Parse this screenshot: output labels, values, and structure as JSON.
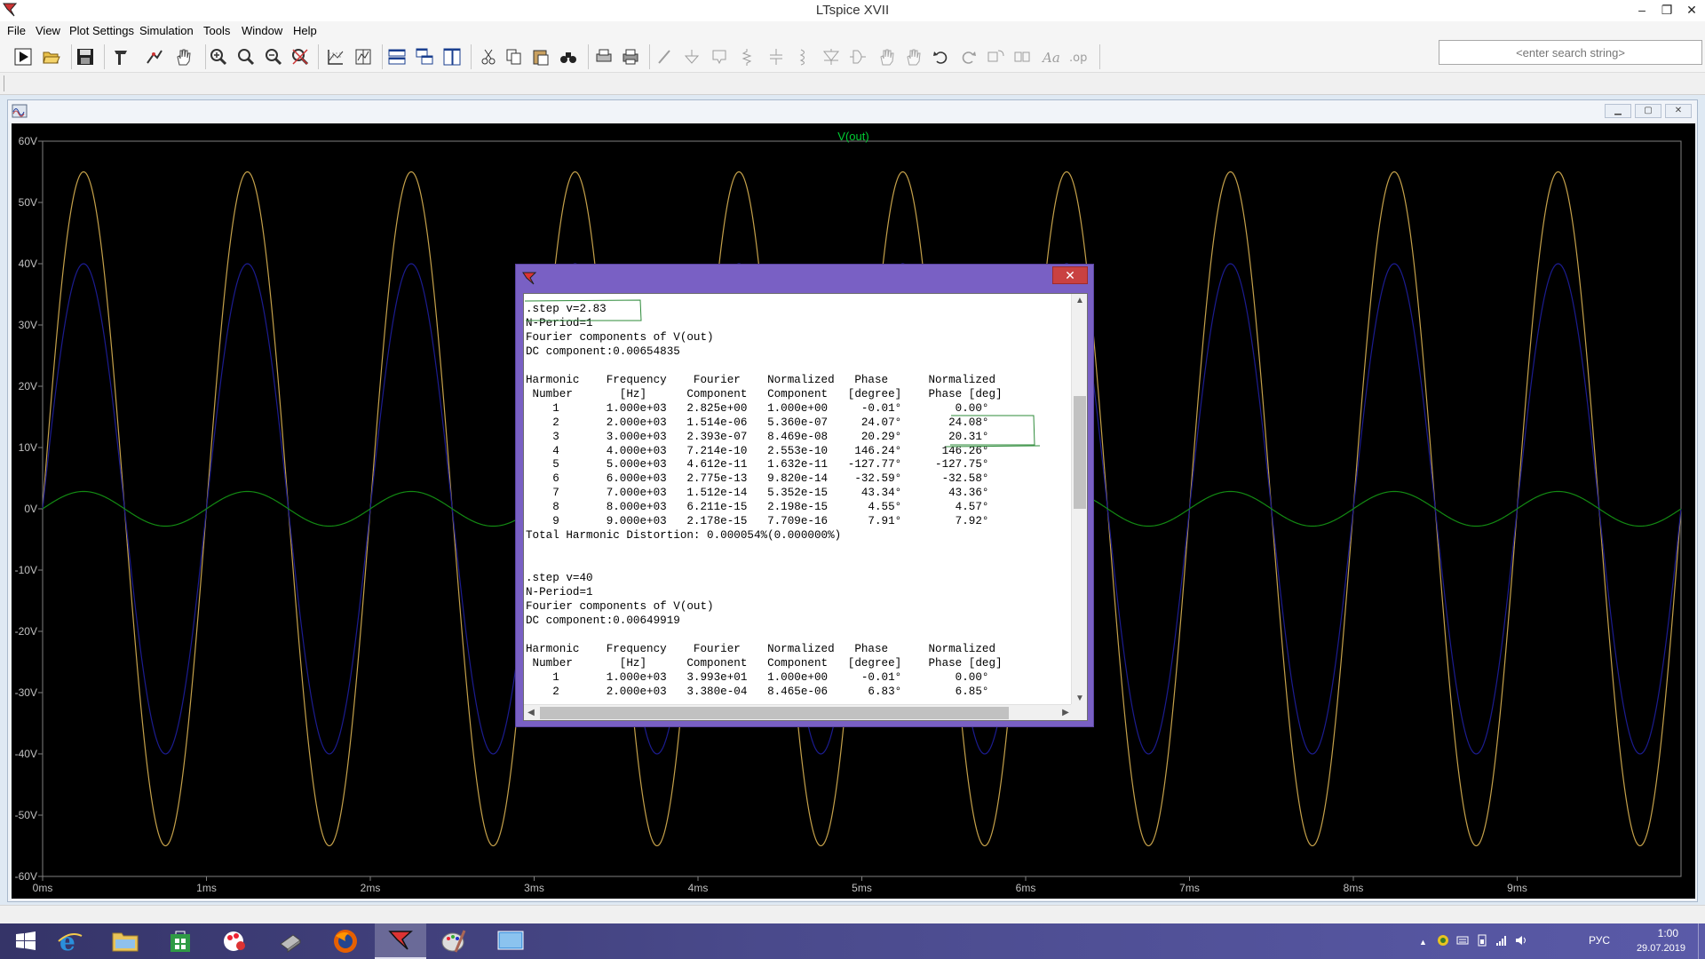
{
  "app": {
    "title": "LTspice XVII"
  },
  "window_controls": {
    "minimize": "–",
    "restore": "❐",
    "close": "✕"
  },
  "menu": [
    "File",
    "View",
    "Plot Settings",
    "Simulation",
    "Tools",
    "Window",
    "Help"
  ],
  "toolbar_icons": [
    "run-icon",
    "open-icon",
    "save-icon",
    "control-panel-icon",
    "pick-visible-traces-icon",
    "pan-icon",
    "zoom-in-icon",
    "zoom-area-icon",
    "zoom-out-icon",
    "zoom-fit-icon",
    "autorange-icon",
    "autorange-y-icon",
    "tile-horizontal-icon",
    "cascade-icon",
    "tile-vertical-icon",
    "cut-icon",
    "copy-icon",
    "paste-icon",
    "find-icon",
    "print-preview-icon",
    "print-icon",
    "wire-icon",
    "ground-icon",
    "label-net-icon",
    "resistor-icon",
    "capacitor-icon",
    "inductor-icon",
    "diode-icon",
    "component-icon",
    "move-icon",
    "drag-icon",
    "undo-icon",
    "redo-icon",
    "rotate-icon",
    "mirror-icon",
    "text-icon",
    "spice-directive-icon"
  ],
  "search": {
    "placeholder": "<enter search string>"
  },
  "plot": {
    "trace_label": "V(out)",
    "colors": {
      "background": "#000000",
      "grid": "#7f7f7f",
      "axis_text": "#c0c0c0",
      "trace_orange": "#c5a14a",
      "trace_blue": "#1c1c90",
      "trace_green": "#138a13",
      "label": "#00cc33"
    }
  },
  "chart_data": {
    "type": "line",
    "title": "V(out)",
    "xlabel": "",
    "ylabel": "",
    "x_ticks": [
      "0ms",
      "1ms",
      "2ms",
      "3ms",
      "4ms",
      "5ms",
      "6ms",
      "7ms",
      "8ms",
      "9ms"
    ],
    "y_ticks": [
      "60V",
      "50V",
      "40V",
      "30V",
      "20V",
      "10V",
      "0V",
      "-10V",
      "-20V",
      "-30V",
      "-40V",
      "-50V",
      "-60V"
    ],
    "xlim": [
      0,
      10
    ],
    "ylim": [
      -60,
      60
    ],
    "x_unit": "ms",
    "y_unit": "V",
    "grid": false,
    "series": [
      {
        "amplitude": 55,
        "frequency_khz": 1,
        "color": "#c5a14a"
      },
      {
        "amplitude": 40,
        "frequency_khz": 1,
        "color": "#1c1c90"
      },
      {
        "amplitude": 2.83,
        "frequency_khz": 1,
        "color": "#138a13"
      }
    ]
  },
  "fourier": {
    "lines": [
      ".step v=2.83",
      "N-Period=1",
      "Fourier components of V(out)",
      "DC component:0.00654835",
      "",
      "Harmonic    Frequency    Fourier    Normalized   Phase      Normalized",
      " Number       [Hz]      Component   Component   [degree]    Phase [deg]",
      "    1       1.000e+03   2.825e+00   1.000e+00     -0.01°        0.00°",
      "    2       2.000e+03   1.514e-06   5.360e-07     24.07°       24.08°",
      "    3       3.000e+03   2.393e-07   8.469e-08     20.29°       20.31°",
      "    4       4.000e+03   7.214e-10   2.553e-10    146.24°      146.26°",
      "    5       5.000e+03   4.612e-11   1.632e-11   -127.77°     -127.75°",
      "    6       6.000e+03   2.775e-13   9.820e-14    -32.59°      -32.58°",
      "    7       7.000e+03   1.512e-14   5.352e-15     43.34°       43.36°",
      "    8       8.000e+03   6.211e-15   2.198e-15      4.55°        4.57°",
      "    9       9.000e+03   2.178e-15   7.709e-16      7.91°        7.92°",
      "Total Harmonic Distortion: 0.000054%(0.000000%)",
      "",
      "",
      ".step v=40",
      "N-Period=1",
      "Fourier components of V(out)",
      "DC component:0.00649919",
      "",
      "Harmonic    Frequency    Fourier    Normalized   Phase      Normalized",
      " Number       [Hz]      Component   Component   [degree]    Phase [deg]",
      "    1       1.000e+03   3.993e+01   1.000e+00     -0.01°        0.00°",
      "    2       2.000e+03   3.380e-04   8.465e-06      6.83°        6.85°"
    ]
  },
  "taskbar": {
    "buttons": [
      "windows-start-icon",
      "internet-explorer-icon",
      "file-explorer-icon",
      "store-icon",
      "paint-icon",
      "scanner-icon",
      "firefox-icon",
      "ltspice-icon",
      "paint-app-icon",
      "desktop-icon"
    ],
    "language": "РУС",
    "time": "1:00",
    "date": "29.07.2019"
  }
}
